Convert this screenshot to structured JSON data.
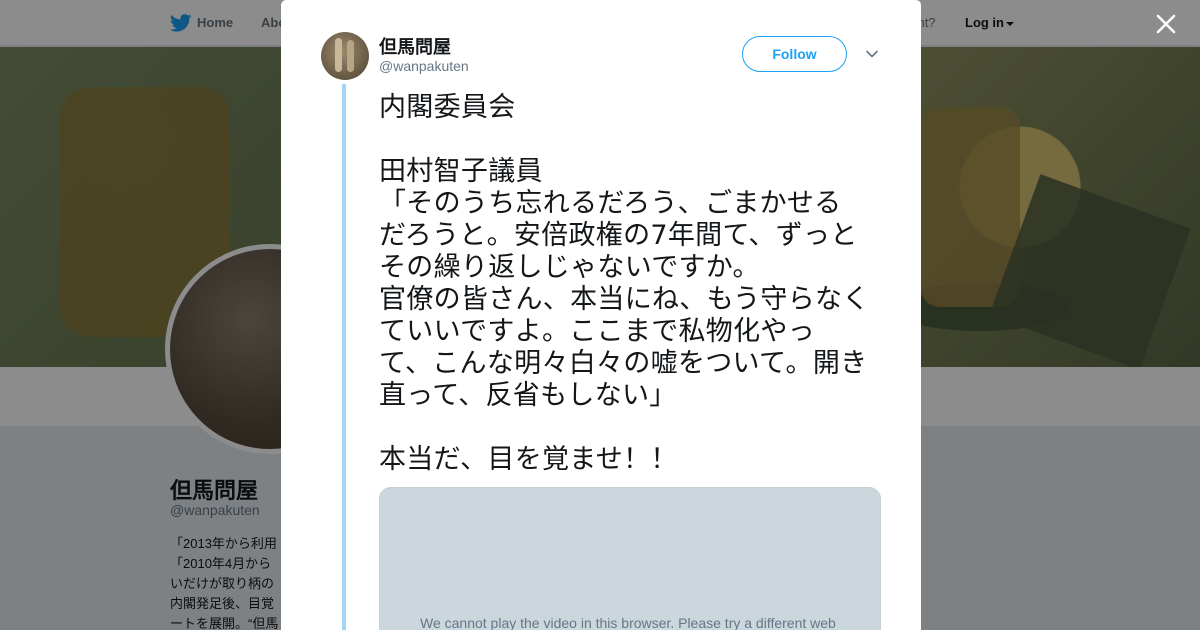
{
  "background_page": {
    "nav": {
      "home_label": "Home",
      "about_label": "Abo",
      "account_text": "ccount?",
      "login_label": "Log in"
    },
    "profile": {
      "name": "但馬問屋",
      "handle": "@wanpakuten",
      "bio_lines": [
        "「2013年から利用",
        "「2010年4月から",
        "いだけが取り柄の",
        "内閣発足後、目覚",
        "ートを展開。“但馬"
      ]
    }
  },
  "modal": {
    "author_name": "但馬問屋",
    "author_handle": "@wanpakuten",
    "follow_label": "Follow",
    "tweet_lines": [
      "内閣委員会",
      "",
      "田村智子議員",
      "「そのうち忘れるだろう、ごまかせる",
      "だろうと。安倍政権の7年間て、ずっと",
      "その繰り返しじゃないですか。",
      "官僚の皆さん、本当にね、もう守らなく",
      "ていいですよ。ここまで私物化やっ",
      "て、こんな明々白々の嘘をついて。開き",
      "直って、反省もしない」",
      "",
      "本当だ、目を覚ませ！！"
    ],
    "video_message": "We cannot play the video in this browser. Please try a different web"
  },
  "icons": {
    "logo": "twitter-bird-icon",
    "close": "close-icon",
    "chevron": "chevron-down-icon"
  },
  "colors": {
    "accent": "#1da1f2",
    "thread_line": "#a3d4f5",
    "video_placeholder": "#ccd6dd",
    "overlay": "rgba(0,0,0,0.45)"
  }
}
